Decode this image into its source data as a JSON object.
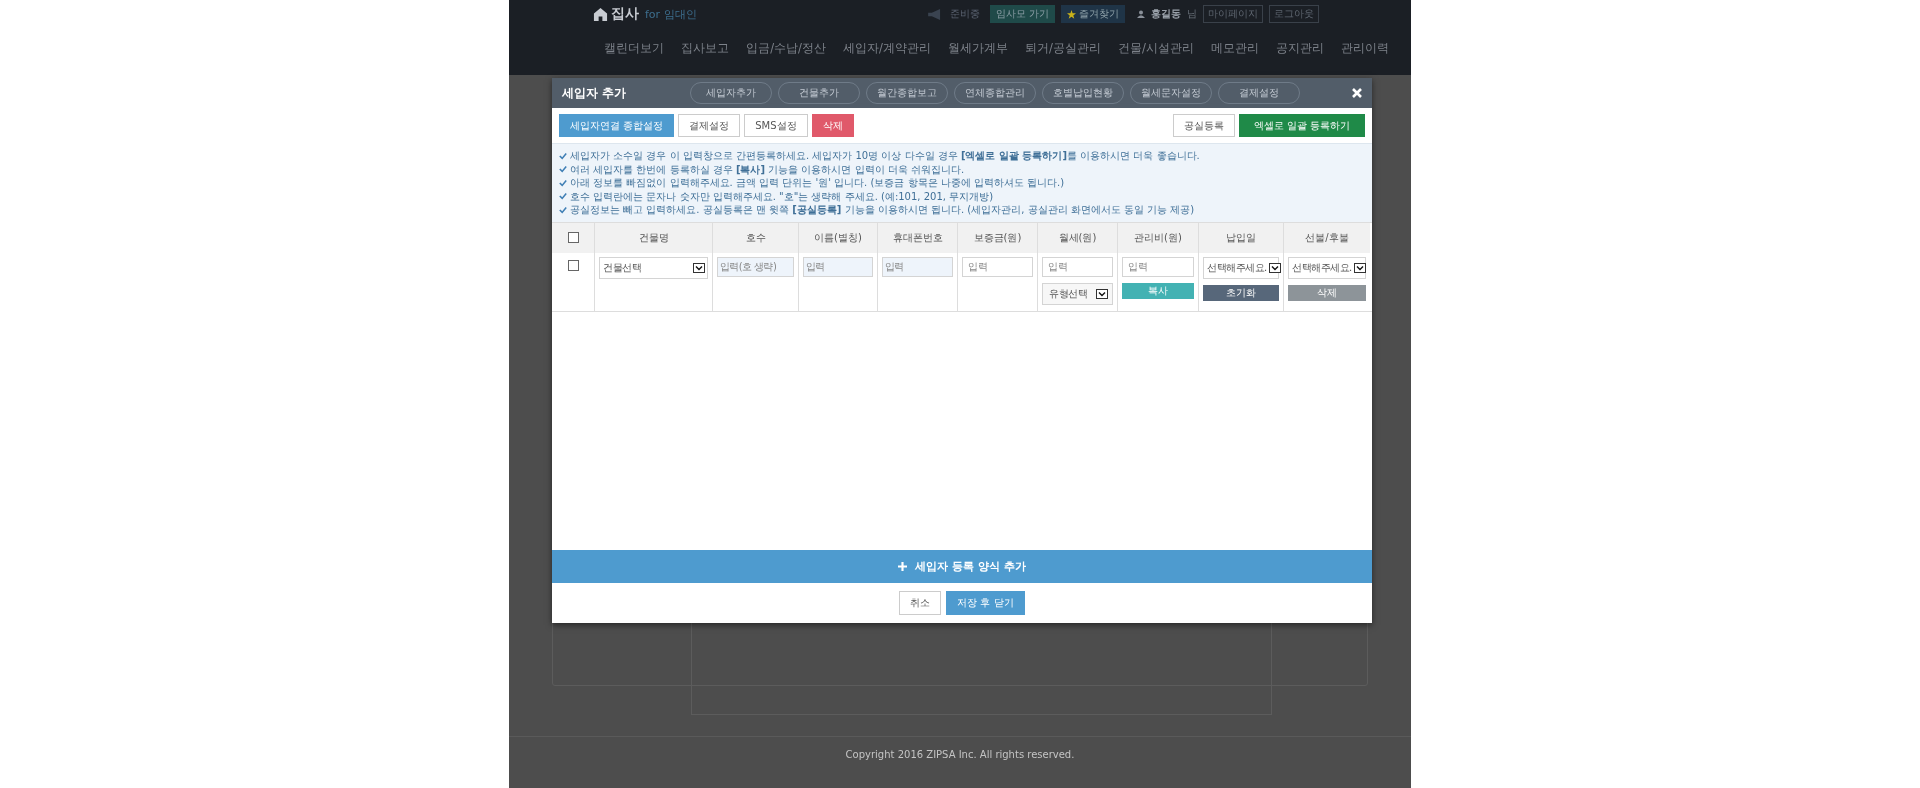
{
  "header": {
    "logo": "집사",
    "logo_sub": "for 임대인",
    "status": "준비중",
    "links": [
      {
        "label": "임사모 가기",
        "kind": "teal"
      },
      {
        "label": "즐겨찾기",
        "kind": "star"
      }
    ],
    "user": "홍길동",
    "user_suffix": "님",
    "account_links": [
      "마이페이지",
      "로그아웃"
    ]
  },
  "nav": [
    "캘린더보기",
    "집사보고",
    "입금/수납/정산",
    "세입자/계약관리",
    "월세가계부",
    "퇴거/공실관리",
    "건물/시설관리",
    "메모관리",
    "공지관리",
    "관리이력"
  ],
  "submenu": [
    "세입자추가",
    "건물추가",
    "월간종합보고",
    "연체종합관리",
    "호별납입현황",
    "월세문자설정",
    "결제설정"
  ],
  "modal": {
    "title": "세입자 추가",
    "toolbar_left": [
      {
        "label": "세입자연결 종합설정",
        "kind": "primary"
      },
      {
        "label": "결제설정",
        "kind": "default"
      },
      {
        "label": "SMS설정",
        "kind": "default"
      },
      {
        "label": "삭제",
        "kind": "danger"
      }
    ],
    "toolbar_right": [
      {
        "label": "공실등록",
        "kind": "default"
      },
      {
        "label": "엑셀로 일괄 등록하기",
        "kind": "success"
      }
    ],
    "notes": [
      "세입자가 소수일 경우 이 입력창으로 간편등록하세요. 세입자가 10명 이상 다수일 경우 **[엑셀로 일괄 등록하기]**를 이용하시면 더욱 좋습니다.",
      "여러 세입자를 한번에 등록하실 경우 **[복사]** 기능을 이용하시면 입력이 더욱 쉬워집니다.",
      "아래 정보를 빠짐없이 입력해주세요. 금액 입력 단위는 '원' 입니다. (보증금 항목은 나중에 입력하셔도 됩니다.)",
      "호수 입력란에는 문자나 숫자만 입력해주세요. \"호\"는 생략해 주세요. (예:101, 201, 무지개방)",
      "공실정보는 빼고 입력하세요. 공실등록은 맨 윗쪽 **[공실등록]** 기능을 이용하시면 됩니다. (세입자관리, 공실관리 화면에서도 동일 기능 제공)"
    ],
    "select_all": {
      "checked": false
    },
    "columns": [
      "건물명",
      "호수",
      "이름(별칭)",
      "휴대폰번호",
      "보증금(원)",
      "월세(원)",
      "관리비(원)",
      "납입일",
      "선불/후불"
    ],
    "rows": [
      {
        "checked": false,
        "fields": [
          {
            "kind": "select",
            "value": "건물선택"
          },
          {
            "kind": "input-shaded",
            "placeholder": "입력(호 생략)"
          },
          {
            "kind": "input-shaded",
            "placeholder": "입력"
          },
          {
            "kind": "input-shaded",
            "placeholder": "입력"
          },
          {
            "kind": "input",
            "placeholder": "입력"
          },
          {
            "kind": "input",
            "placeholder": "입력"
          },
          {
            "kind": "input",
            "placeholder": "입력"
          },
          {
            "kind": "select",
            "value": "선택해주세요."
          },
          {
            "kind": "select",
            "value": "선택해주세요."
          }
        ],
        "type_select": "유형선택",
        "actions": [
          {
            "label": "복사",
            "kind": "copy"
          },
          {
            "label": "초기화",
            "kind": "reset"
          },
          {
            "label": "삭제",
            "kind": "delete"
          }
        ]
      }
    ],
    "add_bar": "세입자 등록 양식 추가",
    "footer_buttons": [
      {
        "label": "취소",
        "kind": "default"
      },
      {
        "label": "저장 후 닫기",
        "kind": "primary"
      }
    ]
  },
  "copyright": "Copyright 2016 ZIPSA Inc. All rights reserved."
}
